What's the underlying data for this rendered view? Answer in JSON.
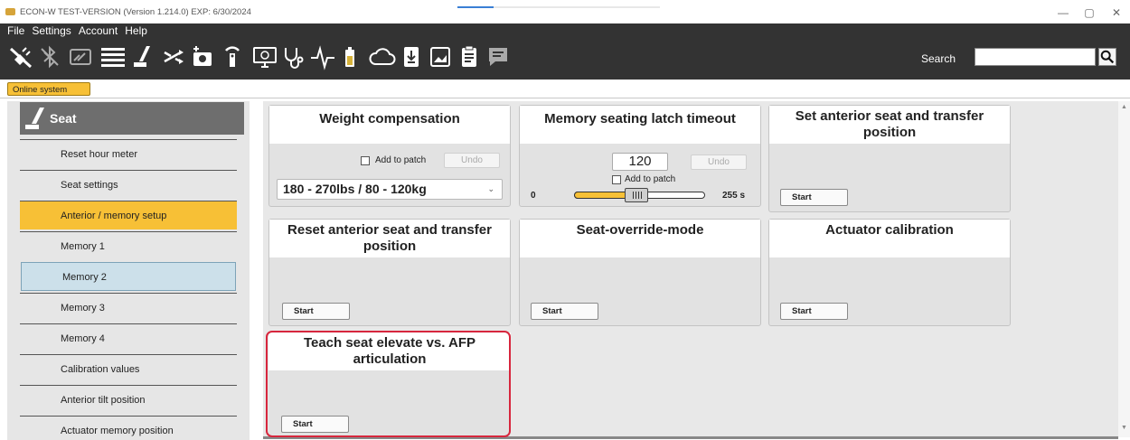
{
  "window": {
    "title": "ECON-W TEST-VERSION (Version 1.214.0) EXP: 6/30/2024",
    "minimize": "—",
    "maximize": "▢",
    "close": "✕"
  },
  "menu": [
    "File",
    "Settings",
    "Account",
    "Help"
  ],
  "toolbar": {
    "icons": [
      "disconnect-plug-icon",
      "bluetooth-icon",
      "display-icon",
      "list-icon",
      "seat-icon",
      "shuffle-icon",
      "camera-add-icon",
      "signal-tower-icon",
      "monitor-icon",
      "stethoscope-icon",
      "pulse-icon",
      "battery-icon",
      "cloud-icon",
      "download-icon",
      "image-icon",
      "clipboard-icon",
      "message-icon"
    ],
    "search_label": "Search",
    "search_value": ""
  },
  "online_tab": "Online system",
  "sidebar": {
    "title": "Seat",
    "items": [
      {
        "label": "Reset hour meter",
        "state": "normal"
      },
      {
        "label": "Seat settings",
        "state": "normal"
      },
      {
        "label": "Anterior / memory setup",
        "state": "active"
      },
      {
        "label": "Memory 1",
        "state": "normal"
      },
      {
        "label": "Memory 2",
        "state": "hover"
      },
      {
        "label": "Memory 3",
        "state": "normal"
      },
      {
        "label": "Memory 4",
        "state": "normal"
      },
      {
        "label": "Calibration values",
        "state": "normal"
      },
      {
        "label": "Anterior tilt position",
        "state": "normal"
      },
      {
        "label": "Actuator memory position",
        "state": "normal"
      }
    ]
  },
  "cards": {
    "weight_compensation": {
      "title": "Weight compensation",
      "add_to_patch": "Add to patch",
      "undo": "Undo",
      "selected": "180 - 270lbs / 80 - 120kg"
    },
    "latch_timeout": {
      "title": "Memory seating latch timeout",
      "value": "120",
      "undo": "Undo",
      "add_to_patch": "Add to patch",
      "min": "0",
      "max": "255 s",
      "slider_fraction": 0.47
    },
    "set_anterior": {
      "title": "Set anterior seat and transfer position",
      "start": "Start"
    },
    "reset_anterior": {
      "title": "Reset anterior seat and transfer position",
      "start": "Start"
    },
    "override_mode": {
      "title": "Seat-override-mode",
      "start": "Start"
    },
    "actuator_cal": {
      "title": "Actuator calibration",
      "start": "Start"
    },
    "teach_elevate": {
      "title": "Teach seat elevate vs. AFP articulation",
      "start": "Start"
    }
  },
  "colors": {
    "accent": "#f7c036",
    "dark": "#333333",
    "highlight": "#d7263d",
    "hover": "#cce0ea"
  }
}
